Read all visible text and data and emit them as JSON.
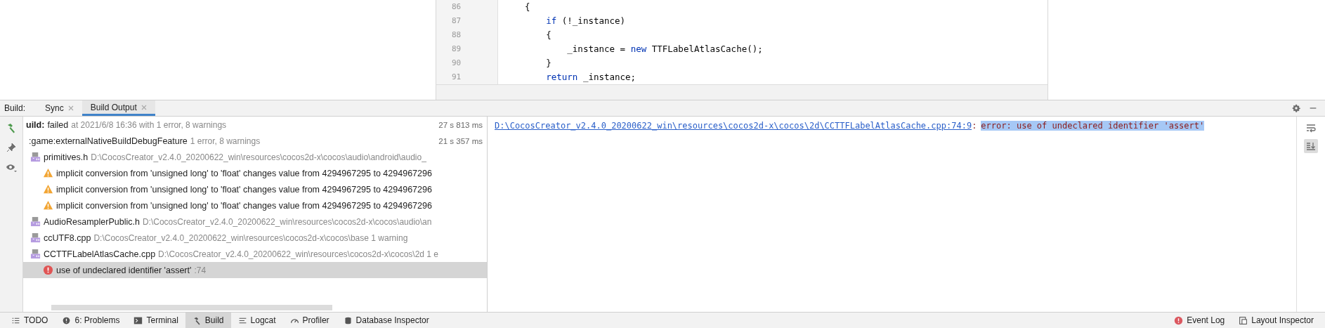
{
  "editor": {
    "lines": [
      {
        "number": "86",
        "tokens": [
          {
            "text": "    {",
            "kind": "plain"
          }
        ]
      },
      {
        "number": "87",
        "tokens": [
          {
            "text": "        if",
            "kind": "keyword"
          },
          {
            "text": " (!_instance)",
            "kind": "plain"
          }
        ]
      },
      {
        "number": "88",
        "tokens": [
          {
            "text": "        {",
            "kind": "plain"
          }
        ]
      },
      {
        "number": "89",
        "tokens": [
          {
            "text": "            _instance = ",
            "kind": "plain"
          },
          {
            "text": "new",
            "kind": "keyword"
          },
          {
            "text": " TTFLabelAtlasCache();",
            "kind": "plain"
          }
        ]
      },
      {
        "number": "90",
        "tokens": [
          {
            "text": "        }",
            "kind": "plain"
          }
        ]
      },
      {
        "number": "91",
        "tokens": [
          {
            "text": "        return",
            "kind": "keyword"
          },
          {
            "text": " _instance;",
            "kind": "plain"
          }
        ]
      }
    ]
  },
  "build_panel": {
    "label": "Build:",
    "tabs": [
      {
        "label": "Sync",
        "selected": false
      },
      {
        "label": "Build Output",
        "selected": true
      }
    ]
  },
  "tree": [
    {
      "kind": "build",
      "name": "uild:",
      "status": "failed",
      "detail": "at 2021/6/8 16:36 with 1 error, 8 warnings",
      "time": "27 s 813 ms",
      "selected": false,
      "children": [
        {
          "kind": "task",
          "name": ":game:externalNativeBuildDebugFeature",
          "detail": "1 error, 8 warnings",
          "time": "21 s 357 ms",
          "selected": false,
          "children": [
            {
              "kind": "file",
              "name": "primitives.h",
              "detail": "D:\\CocosCreator_v2.4.0_20200622_win\\resources\\cocos2d-x\\cocos\\audio\\android\\audio_",
              "selected": false,
              "children": [
                {
                  "kind": "warning",
                  "name": "implicit conversion from 'unsigned long' to 'float' changes value from 4294967295 to 4294967296",
                  "selected": false
                },
                {
                  "kind": "warning",
                  "name": "implicit conversion from 'unsigned long' to 'float' changes value from 4294967295 to 4294967296",
                  "selected": false
                },
                {
                  "kind": "warning",
                  "name": "implicit conversion from 'unsigned long' to 'float' changes value from 4294967295 to 4294967296",
                  "selected": false
                }
              ]
            },
            {
              "kind": "file",
              "name": "AudioResamplerPublic.h",
              "detail": "D:\\CocosCreator_v2.4.0_20200622_win\\resources\\cocos2d-x\\cocos\\audio\\an",
              "selected": false
            },
            {
              "kind": "file",
              "name": "ccUTF8.cpp",
              "detail": "D:\\CocosCreator_v2.4.0_20200622_win\\resources\\cocos2d-x\\cocos\\base 1 warning",
              "selected": false
            },
            {
              "kind": "file",
              "name": "CCTTFLabelAtlasCache.cpp",
              "detail": "D:\\CocosCreator_v2.4.0_20200622_win\\resources\\cocos2d-x\\cocos\\2d 1 e",
              "selected": false,
              "children": [
                {
                  "kind": "error",
                  "name": "use of undeclared identifier 'assert'",
                  "detail": ":74",
                  "selected": true
                }
              ]
            }
          ]
        }
      ]
    }
  ],
  "console": {
    "link": "D:\\CocosCreator_v2.4.0_20200622_win\\resources\\cocos2d-x\\cocos\\2d\\CCTTFLabelAtlasCache.cpp:74:9",
    "separator": ":",
    "message": "error: use of undeclared identifier 'assert'",
    "message_selected": true,
    "scroll_to_end": true
  },
  "bottom_tabs": [
    {
      "label": "TODO",
      "selected": false
    },
    {
      "label": "6: Problems",
      "selected": false
    },
    {
      "label": "Terminal",
      "selected": false
    },
    {
      "label": "Build",
      "selected": true
    },
    {
      "label": "Logcat",
      "selected": false
    },
    {
      "label": "Profiler",
      "selected": false
    },
    {
      "label": "Database Inspector",
      "selected": false
    }
  ],
  "bottom_right_tabs": [
    {
      "label": "Event Log",
      "selected": false
    },
    {
      "label": "Layout Inspector",
      "selected": false
    }
  ]
}
